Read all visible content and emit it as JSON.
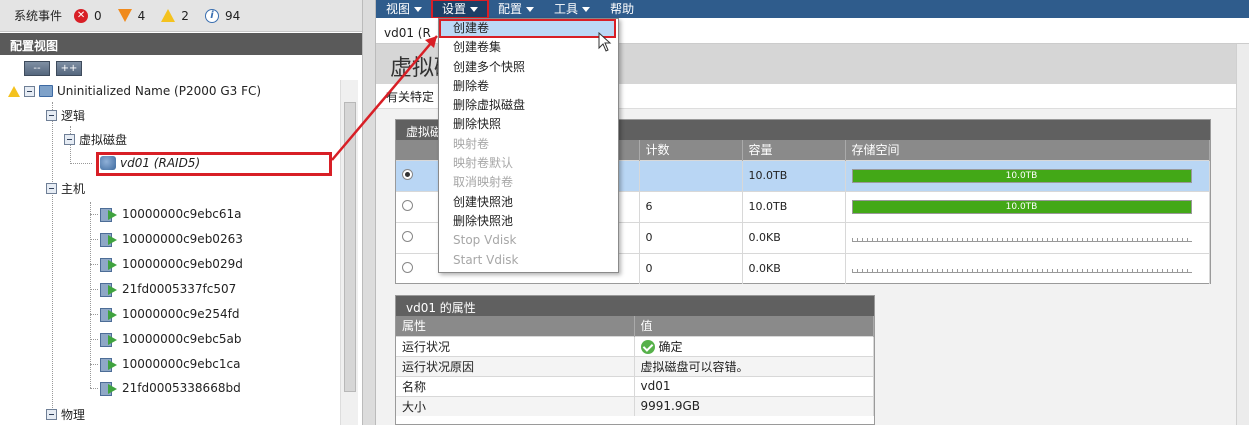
{
  "events": {
    "label": "系统事件",
    "critical_count": "0",
    "error_count": "4",
    "warning_count": "2",
    "info_count": "94"
  },
  "left_panel": {
    "title": "配置视图",
    "collapse_label": "--",
    "expand_label": "++"
  },
  "tree": {
    "system": "Uninitialized Name (P2000 G3 FC)",
    "logical": "逻辑",
    "vdisks": "虚拟磁盘",
    "vdisk_selected": "vd01 (RAID5)",
    "hosts": "主机",
    "host_items": [
      "10000000c9ebc61a",
      "10000000c9eb0263",
      "10000000c9eb029d",
      "21fd0005337fc507",
      "10000000c9e254fd",
      "10000000c9ebc5ab",
      "10000000c9ebc1ca",
      "21fd0005338668bd"
    ],
    "physical": "物理"
  },
  "menubar": {
    "items": [
      {
        "label": "视图",
        "caret": true
      },
      {
        "label": "设置",
        "caret": true
      },
      {
        "label": "配置",
        "caret": true
      },
      {
        "label": "工具",
        "caret": true
      },
      {
        "label": "帮助",
        "caret": false
      }
    ]
  },
  "breadcrumb": "vd01 (R",
  "page": {
    "title": "虚拟磁",
    "description": "有关特定"
  },
  "dropdown": {
    "items": [
      {
        "label": "创建卷",
        "state": "highlighted"
      },
      {
        "label": "创建卷集",
        "state": "enabled"
      },
      {
        "label": "创建多个快照",
        "state": "enabled"
      },
      {
        "label": "删除卷",
        "state": "enabled"
      },
      {
        "label": "删除虚拟磁盘",
        "state": "enabled"
      },
      {
        "label": "删除快照",
        "state": "enabled"
      },
      {
        "label": "映射卷",
        "state": "disabled"
      },
      {
        "label": "映射卷默认",
        "state": "disabled"
      },
      {
        "label": "取消映射卷",
        "state": "disabled"
      },
      {
        "label": "创建快照池",
        "state": "enabled"
      },
      {
        "label": "删除快照池",
        "state": "enabled"
      },
      {
        "label": "Stop Vdisk",
        "state": "disabled"
      },
      {
        "label": "Start Vdisk",
        "state": "disabled"
      }
    ]
  },
  "vdisk_table": {
    "title": "虚拟磁",
    "columns": [
      "",
      "计数",
      "容量",
      "存储空间"
    ],
    "rows": [
      {
        "selected": true,
        "count": "",
        "capacity": "10.0TB",
        "bar_label": "10.0TB",
        "fill": 1.0
      },
      {
        "selected": false,
        "count": "6",
        "capacity": "10.0TB",
        "bar_label": "10.0TB",
        "fill": 1.0
      },
      {
        "selected": false,
        "count": "0",
        "capacity": "0.0KB",
        "bar_label": "",
        "fill": 0
      },
      {
        "selected": false,
        "count": "0",
        "capacity": "0.0KB",
        "bar_label": "",
        "fill": 0
      }
    ]
  },
  "properties": {
    "title": "vd01 的属性",
    "columns": [
      "属性",
      "值"
    ],
    "rows": [
      {
        "name": "运行状况",
        "value": "确定",
        "ok": true
      },
      {
        "name": "运行状况原因",
        "value": "虚拟磁盘可以容错。",
        "ok": false
      },
      {
        "name": "名称",
        "value": "vd01",
        "ok": false
      },
      {
        "name": "大小",
        "value": "9991.9GB",
        "ok": false
      }
    ]
  },
  "colors": {
    "menubar": "#2f5c8c",
    "highlight": "#d81f26",
    "bar_fill": "#43a817",
    "selected_row": "#b9d6f4"
  }
}
